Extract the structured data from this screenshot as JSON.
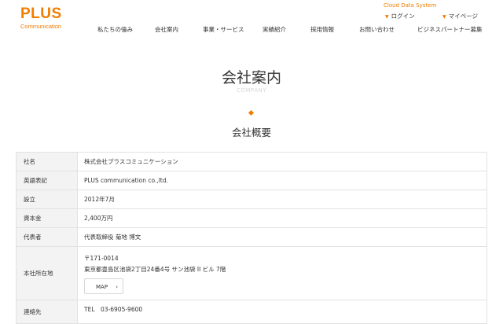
{
  "header": {
    "logo_main": "PLUS",
    "logo_sub": "Communication",
    "cloud_link": "Cloud Data System",
    "login": "ログイン",
    "mypage": "マイページ",
    "nav": [
      "私たちの強み",
      "会社案内",
      "事業・サービス",
      "実績紹介",
      "採用情報",
      "お問い合わせ",
      "ビジネスパートナー募集"
    ]
  },
  "main": {
    "title": "会社案内",
    "subtitle": "COMPANY",
    "section_title": "会社概要"
  },
  "table": {
    "rows": [
      {
        "label": "社名",
        "value": "株式会社プラスコミュニケーション"
      },
      {
        "label": "英語表記",
        "value": "PLUS communication co.,ltd."
      },
      {
        "label": "設立",
        "value": "2012年7月"
      },
      {
        "label": "資本金",
        "value": "2,400万円"
      },
      {
        "label": "代表者",
        "value": "代表取締役 菊地 博文"
      }
    ],
    "address": {
      "label": "本社所在地",
      "postal": "〒171-0014",
      "street": "東京都豊島区池袋2丁目24番4号 サン池袋 II ビル 7階",
      "map_button": "MAP"
    },
    "contact": {
      "label": "連絡先",
      "tel": "TEL　03-6905-9600"
    }
  },
  "colors": {
    "accent": "#f07d00",
    "label_bg": "#f3f3f3",
    "border": "#e2e2e2"
  }
}
